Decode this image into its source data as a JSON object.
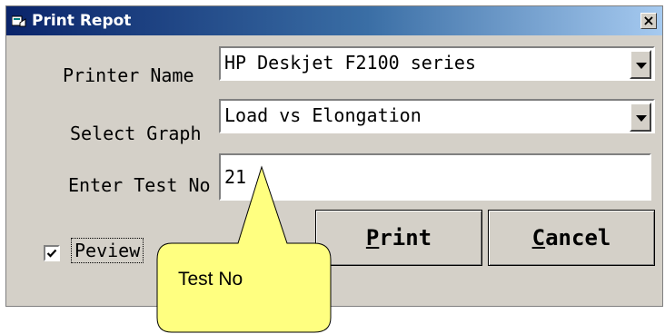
{
  "window": {
    "title": "Print Repot",
    "close_label": "×"
  },
  "form": {
    "printer_label": "Printer Name",
    "printer_value": "HP Deskjet F2100 series",
    "graph_label": "Select Graph",
    "graph_value": "Load vs Elongation",
    "test_label": "Enter Test No",
    "test_value": "21"
  },
  "buttons": {
    "print_hotkey": "P",
    "print_rest": "rint",
    "cancel_hotkey": "C",
    "cancel_rest": "ancel"
  },
  "preview": {
    "label": "Peview",
    "checked": true
  },
  "callout": {
    "text": "Test No",
    "fill_color": "#ffff80"
  },
  "colors": {
    "titlebar_start": "#0a246a",
    "window_bg": "#d4d0c8"
  }
}
